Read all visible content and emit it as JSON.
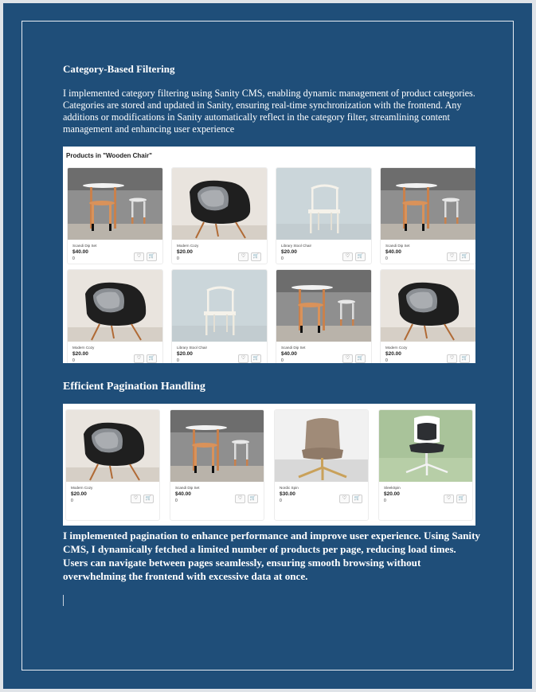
{
  "section1": {
    "heading": "Category-Based Filtering",
    "body": "I implemented category filtering using Sanity CMS, enabling dynamic management of product categories. Categories are stored and updated in Sanity, ensuring real-time synchronization with the frontend. Any additions or modifications in Sanity automatically reflect in the category filter, streamlining content management and enhancing user experience"
  },
  "screenshot1": {
    "title": "Products in \"Wooden Chair\"",
    "products": [
      {
        "name": "Scandi Dip Set",
        "price": "$40.00",
        "count": "0",
        "image": "stools-image"
      },
      {
        "name": "Modern Cozy",
        "price": "$20.00",
        "count": "0",
        "image": "armchair-image"
      },
      {
        "name": "Library Stool Chair",
        "price": "$20.00",
        "count": "0",
        "image": "white-chair-image"
      },
      {
        "name": "Scandi Dip Set",
        "price": "$40.00",
        "count": "0",
        "image": "stools-image"
      },
      {
        "name": "Modern Cozy",
        "price": "$20.00",
        "count": "0",
        "image": "armchair-image"
      },
      {
        "name": "Library Stool Chair",
        "price": "$20.00",
        "count": "0",
        "image": "white-chair-image"
      },
      {
        "name": "Scandi Dip Set",
        "price": "$40.00",
        "count": "0",
        "image": "stools-image"
      },
      {
        "name": "Modern Cozy",
        "price": "$20.00",
        "count": "0",
        "image": "armchair-image"
      }
    ]
  },
  "section2": {
    "heading": "Efficient Pagination Handling",
    "body": "I implemented pagination to enhance performance and improve user experience. Using Sanity CMS, I dynamically fetched a limited number of products per page, reducing load times. Users can navigate between pages seamlessly, ensuring smooth browsing without overwhelming the frontend with excessive data at once."
  },
  "screenshot2": {
    "products": [
      {
        "name": "Modern Cozy",
        "price": "$20.00",
        "count": "0",
        "image": "armchair-image"
      },
      {
        "name": "Scandi Dip Set",
        "price": "$40.00",
        "count": "0",
        "image": "stools-image"
      },
      {
        "name": "Nordic Spin",
        "price": "$30.00",
        "count": "0",
        "image": "beige-chair-image"
      },
      {
        "name": "SleekSpin",
        "price": "$20.00",
        "count": "0",
        "image": "office-chair-image"
      }
    ]
  },
  "icons": {
    "like": "heart-icon",
    "cart": "cart-icon",
    "like_glyph": "♡",
    "cart_glyph": "🛒"
  },
  "colors": {
    "page_background": "#1f4e79",
    "text": "#ffffff"
  }
}
